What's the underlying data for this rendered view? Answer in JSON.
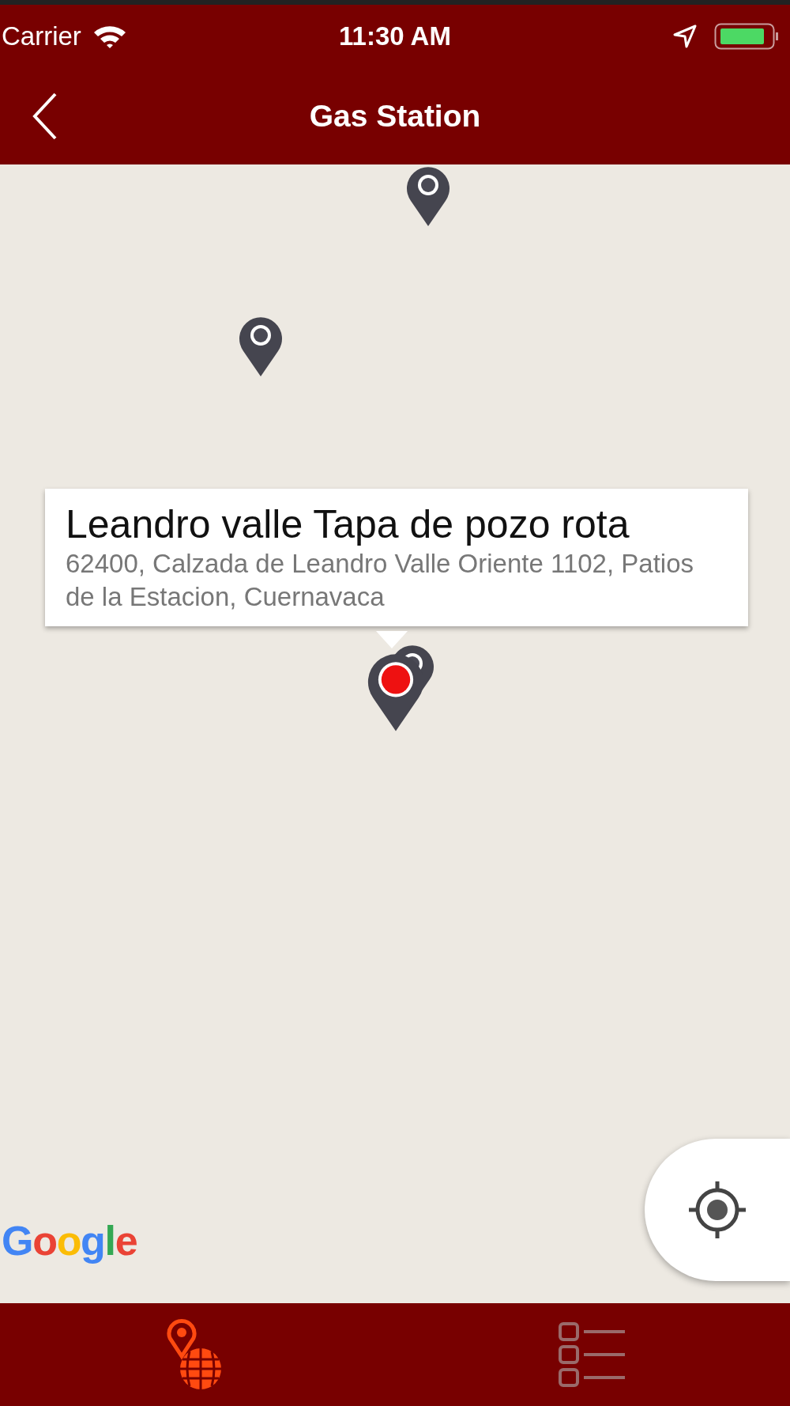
{
  "status_bar": {
    "carrier": "Carrier",
    "time": "11:30 AM"
  },
  "nav_bar": {
    "title": "Gas Station"
  },
  "map": {
    "markers": [
      {
        "selected": false
      },
      {
        "selected": false
      },
      {
        "selected": false
      },
      {
        "selected": true
      }
    ],
    "callout": {
      "title": "Leandro valle Tapa de pozo rota",
      "address": "62400, Calzada de Leandro Valle Oriente 1102, Patios de la Estacion, Cuernavaca"
    },
    "attribution": "Google"
  },
  "tabs": [
    {
      "kind": "map",
      "selected": true
    },
    {
      "kind": "list",
      "selected": false
    }
  ]
}
